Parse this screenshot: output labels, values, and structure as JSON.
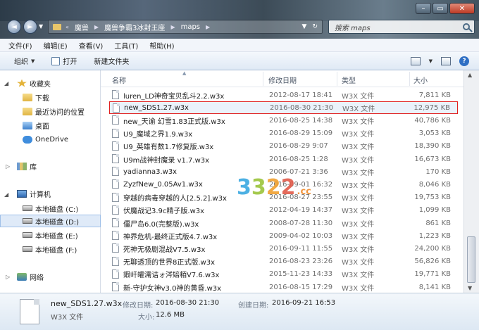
{
  "window": {
    "controls": {
      "minimize": "–",
      "maximize": "▭",
      "close": "✕"
    }
  },
  "nav": {
    "back": "◄",
    "forward": "►",
    "dropdown": "▼",
    "breadcrumb": [
      "魔兽",
      "魔兽争霸3冰封王座",
      "maps"
    ],
    "refresh": "↻",
    "dropdown_arrow": "▼"
  },
  "search": {
    "placeholder": "搜索 maps"
  },
  "menu": [
    "文件(F)",
    "编辑(E)",
    "查看(V)",
    "工具(T)",
    "帮助(H)"
  ],
  "toolbar": {
    "organize": "组织",
    "open": "打开",
    "new_folder": "新建文件夹",
    "help": "?"
  },
  "navpane": {
    "favorites": "收藏夹",
    "downloads": "下载",
    "recent": "最近访问的位置",
    "desktop": "桌面",
    "onedrive": "OneDrive",
    "libraries": "库",
    "computer": "计算机",
    "drives": [
      "本地磁盘 (C:)",
      "本地磁盘 (D:)",
      "本地磁盘 (E:)",
      "本地磁盘 (F:)"
    ],
    "network": "网络"
  },
  "columns": {
    "name": "名称",
    "date": "修改日期",
    "type": "类型",
    "size": "大小"
  },
  "files": [
    {
      "name": "luren_LD神奇宝贝乱斗2.2.w3x",
      "date": "2012-08-17 18:41",
      "type": "W3X 文件",
      "size": "7,811 KB"
    },
    {
      "name": "new_SDS1.27.w3x",
      "date": "2016-08-30 21:30",
      "type": "W3X 文件",
      "size": "12,975 KB"
    },
    {
      "name": "new_天谕 幻雪1.83正式版.w3x",
      "date": "2016-08-25 14:38",
      "type": "W3X 文件",
      "size": "40,786 KB"
    },
    {
      "name": "U9_魔域之界1.9.w3x",
      "date": "2016-08-29 15:09",
      "type": "W3X 文件",
      "size": "3,053 KB"
    },
    {
      "name": "U9_英雄有数1.7修复版.w3x",
      "date": "2016-08-29 9:07",
      "type": "W3X 文件",
      "size": "18,390 KB"
    },
    {
      "name": "U9m战神封魔录 v1.7.w3x",
      "date": "2016-08-25 1:28",
      "type": "W3X 文件",
      "size": "16,673 KB"
    },
    {
      "name": "yadianna3.w3x",
      "date": "2006-07-21 3:36",
      "type": "W3X 文件",
      "size": "170 KB"
    },
    {
      "name": "ZyzfNew_0.05Av1.w3x",
      "date": "2016-09-01 16:32",
      "type": "W3X 文件",
      "size": "8,046 KB"
    },
    {
      "name": "穿越的病毒穿越的人[2.5.2].w3x",
      "date": "2016-08-27 23:55",
      "type": "W3X 文件",
      "size": "19,753 KB"
    },
    {
      "name": "伏魔战记3.9c精子版.w3x",
      "date": "2012-04-19 14:37",
      "type": "W3X 文件",
      "size": "1,099 KB"
    },
    {
      "name": "僵尸岛6.0(完整版).w3x",
      "date": "2008-07-28 11:30",
      "type": "W3X 文件",
      "size": "861 KB"
    },
    {
      "name": "神界危机-最终正式版4.7.w3x",
      "date": "2009-04-02 10:03",
      "type": "W3X 文件",
      "size": "1,223 KB"
    },
    {
      "name": "死神无极剧混战V7.5.w3x",
      "date": "2016-09-11 11:55",
      "type": "W3X 文件",
      "size": "24,200 KB"
    },
    {
      "name": "无聊透顶的世界8正式版.w3x",
      "date": "2016-08-23 23:26",
      "type": "W3X 文件",
      "size": "56,826 KB"
    },
    {
      "name": "鍜屽皬濡诘ォ涔婄粨V7.6.w3x",
      "date": "2015-11-23 14:33",
      "type": "W3X 文件",
      "size": "19,771 KB"
    },
    {
      "name": "新-守护女神v3.0神的黄昏.w3x",
      "date": "2016-08-15 17:29",
      "type": "W3X 文件",
      "size": "8,141 KB"
    }
  ],
  "selected_index": 1,
  "details": {
    "filename": "new_SDS1.27.w3x",
    "filetype": "W3X 文件",
    "modified_label": "修改日期:",
    "modified_value": "2016-08-30 21:30",
    "created_label": "创建日期:",
    "created_value": "2016-09-21 16:53",
    "size_label": "大小:",
    "size_value": "12.6 MB"
  },
  "watermark": {
    "digits": [
      "3",
      "3",
      "2",
      "2"
    ],
    "suffix": ".cc",
    "colors": [
      "#39a8e0",
      "#9bc43a",
      "#f0a030",
      "#e25a4a"
    ]
  }
}
